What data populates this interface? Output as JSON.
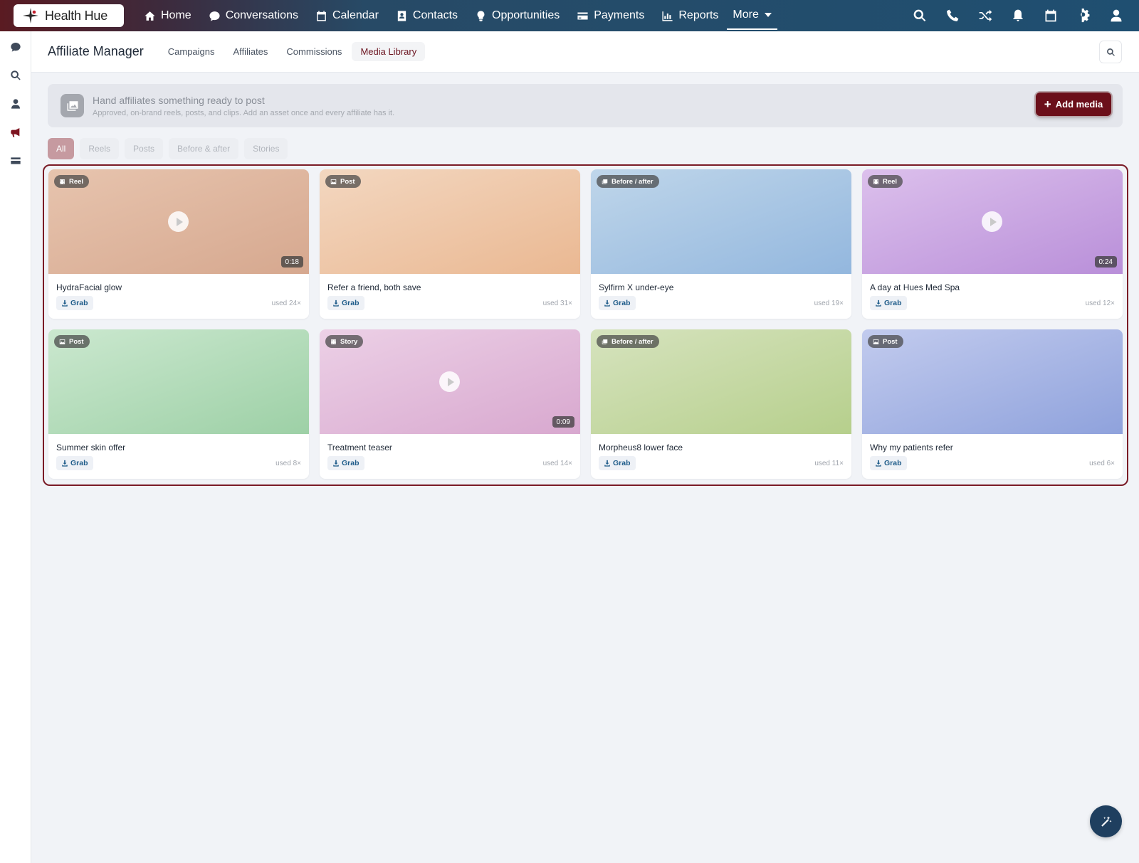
{
  "brand": {
    "name": "Health Hue"
  },
  "nav": {
    "items": [
      {
        "label": "Home"
      },
      {
        "label": "Conversations"
      },
      {
        "label": "Calendar"
      },
      {
        "label": "Contacts"
      },
      {
        "label": "Opportunities"
      },
      {
        "label": "Payments"
      },
      {
        "label": "Reports"
      },
      {
        "label": "More"
      }
    ]
  },
  "top_icons": [
    "search-icon",
    "phone-icon",
    "shuffle-icon",
    "bell-icon",
    "calendar-icon",
    "gear-icon",
    "user-icon"
  ],
  "rail_icons": [
    "chat-icon",
    "search-icon",
    "user-icon",
    "megaphone-icon",
    "card-icon"
  ],
  "subheader": {
    "title": "Affiliate Manager",
    "tabs": [
      {
        "label": "Campaigns"
      },
      {
        "label": "Affiliates"
      },
      {
        "label": "Commissions"
      },
      {
        "label": "Media Library",
        "active": true
      }
    ]
  },
  "banner": {
    "title": "Hand affiliates something ready to post",
    "subtitle": "Approved, on-brand reels, posts, and clips. Add an asset once and every affiliate has it.",
    "button": "Add media"
  },
  "filters": [
    {
      "label": "All",
      "active": true
    },
    {
      "label": "Reels"
    },
    {
      "label": "Posts"
    },
    {
      "label": "Before & after"
    },
    {
      "label": "Stories"
    }
  ],
  "media": [
    {
      "type": "Reel",
      "title": "HydraFacial glow",
      "duration": "0:18",
      "grab": "Grab",
      "used": "used 24×",
      "gradient": [
        "#e7c4ae",
        "#d6a88f"
      ]
    },
    {
      "type": "Post",
      "title": "Refer a friend, both save",
      "duration": "",
      "grab": "Grab",
      "used": "used 31×",
      "gradient": [
        "#f3d7c0",
        "#eab892"
      ]
    },
    {
      "type": "Before / after",
      "title": "Sylfirm X under-eye",
      "duration": "",
      "grab": "Grab",
      "used": "used 19×",
      "gradient": [
        "#bfd6ea",
        "#93b7de"
      ]
    },
    {
      "type": "Reel",
      "title": "A day at Hues Med Spa",
      "duration": "0:24",
      "grab": "Grab",
      "used": "used 12×",
      "gradient": [
        "#dcc0ec",
        "#b98fd9"
      ]
    },
    {
      "type": "Post",
      "title": "Summer skin offer",
      "duration": "",
      "grab": "Grab",
      "used": "used 8×",
      "gradient": [
        "#cbe8cf",
        "#9dd0a6"
      ]
    },
    {
      "type": "Story",
      "title": "Treatment teaser",
      "duration": "0:09",
      "grab": "Grab",
      "used": "used 14×",
      "gradient": [
        "#ecd0e6",
        "#d8a8cf"
      ]
    },
    {
      "type": "Before / after",
      "title": "Morpheus8 lower face",
      "duration": "",
      "grab": "Grab",
      "used": "used 11×",
      "gradient": [
        "#d6e3be",
        "#b6cf8c"
      ]
    },
    {
      "type": "Post",
      "title": "Why my patients refer",
      "duration": "",
      "grab": "Grab",
      "used": "used 6×",
      "gradient": [
        "#c2cbee",
        "#8fa2dc"
      ]
    }
  ],
  "colors": {
    "accent": "#6b0f1a",
    "frame": "#7a1b26",
    "link": "#1f5c8a"
  }
}
